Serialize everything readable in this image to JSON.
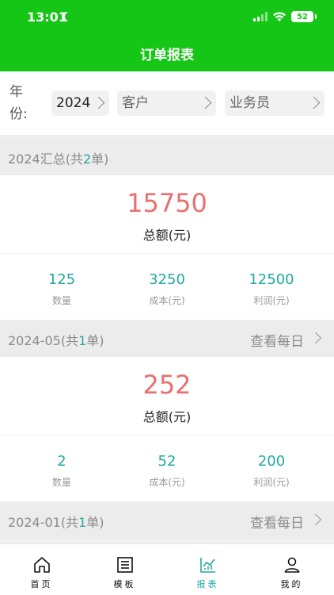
{
  "status_bar": {
    "time": "13:01",
    "battery": "52",
    "icons": [
      "moon-icon",
      "signal-icon",
      "wifi-icon",
      "battery-icon"
    ]
  },
  "nav": {
    "title": "订单报表"
  },
  "filters": {
    "year_label": "年份:",
    "year_value": "2024",
    "customer_placeholder": "客户",
    "salesperson_placeholder": "业务员"
  },
  "annual_summary": {
    "title_prefix": "2024汇总(共",
    "count": "2",
    "title_suffix": "单)",
    "total_amount": "15750",
    "total_label": "总额(元)",
    "stats": [
      {
        "value": "125",
        "label": "数量"
      },
      {
        "value": "3250",
        "label": "成本(元)"
      },
      {
        "value": "12500",
        "label": "利润(元)"
      }
    ]
  },
  "months": [
    {
      "title_prefix": "2024-05(共",
      "count": "1",
      "title_suffix": "单)",
      "daily_link": "查看每日",
      "total_amount": "252",
      "total_label": "总额(元)",
      "stats": [
        {
          "value": "2",
          "label": "数量"
        },
        {
          "value": "52",
          "label": "成本(元)"
        },
        {
          "value": "200",
          "label": "利润(元)"
        }
      ]
    },
    {
      "title_prefix": "2024-01(共",
      "count": "1",
      "title_suffix": "单)",
      "daily_link": "查看每日"
    }
  ],
  "tabbar": {
    "items": [
      {
        "label": "首页",
        "icon": "home-icon"
      },
      {
        "label": "模板",
        "icon": "template-icon"
      },
      {
        "label": "报表",
        "icon": "chart-icon",
        "active": true
      },
      {
        "label": "我的",
        "icon": "user-icon"
      }
    ],
    "active_color": "#22a8a0"
  },
  "colors": {
    "brand_green": "#16c616",
    "amount_red": "#ea6f6f",
    "teal": "#22a8a0"
  }
}
